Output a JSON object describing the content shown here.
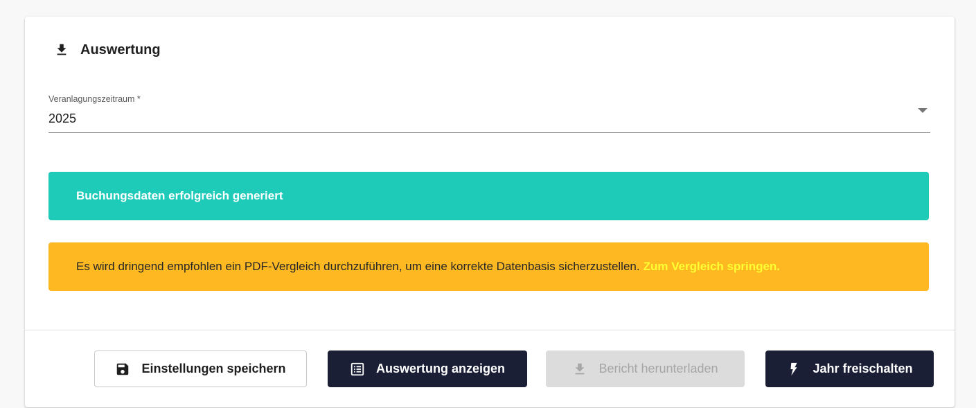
{
  "card": {
    "title": "Auswertung",
    "title_icon": "download-icon"
  },
  "period_field": {
    "label": "Veranlagungszeitraum *",
    "value": "2025",
    "icon": "chevron-down-icon"
  },
  "alerts": {
    "success": {
      "text": "Buchungsdaten erfolgreich generiert",
      "color": "#1ecbb8"
    },
    "warning": {
      "text": "Es wird dringend empfohlen ein PDF-Vergleich durchzuführen, um eine korrekte Datenbasis sicherzustellen.",
      "link": "Zum Vergleich springen.",
      "color": "#fdb822",
      "link_color": "#ffff33"
    }
  },
  "actions": {
    "save": {
      "label": "Einstellungen speichern",
      "icon": "floppy-disk-icon"
    },
    "view": {
      "label": "Auswertung anzeigen",
      "icon": "list-icon"
    },
    "download": {
      "label": "Bericht herunterladen",
      "icon": "download-icon",
      "disabled": true
    },
    "unlock": {
      "label": "Jahr freischalten",
      "icon": "lightning-icon"
    }
  },
  "colors": {
    "primary_dark": "#1a1f36",
    "disabled_bg": "#dcdcdc"
  }
}
